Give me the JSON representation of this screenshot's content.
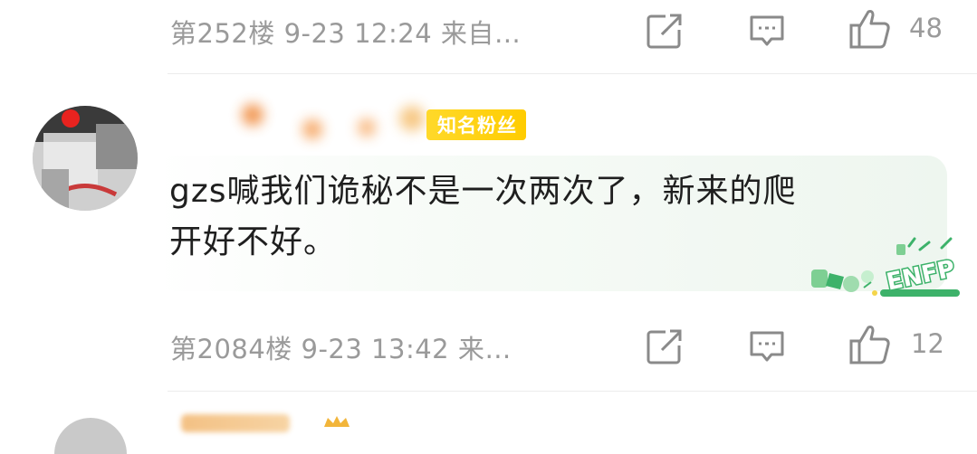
{
  "comments": [
    {
      "floor_meta": "第252楼 9-23 12:24 来自…",
      "like_count": "48"
    },
    {
      "user_badge": "知名粉丝",
      "text_line1": "gzs喊我们诡秘不是一次两次了，新来的爬",
      "text_line2": "开好不好。",
      "decoration": "ENFP",
      "floor_meta": "第2084楼 9-23 13:42 来…",
      "like_count": "12"
    }
  ],
  "icons": {
    "repost": "share-external-icon",
    "comment": "comment-bubble-icon",
    "like": "thumbs-up-icon",
    "crown": "crown-icon"
  },
  "colors": {
    "meta_text": "#9a9a9a",
    "badge_bg": "#ffd21f",
    "bubble_tint": "#eef6ef",
    "enfp_green": "#3db26a"
  }
}
